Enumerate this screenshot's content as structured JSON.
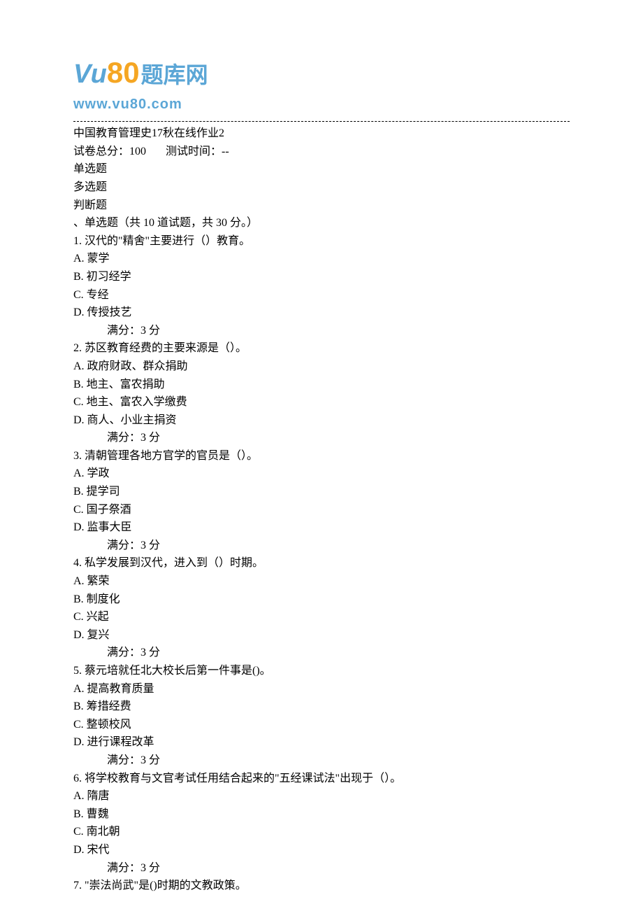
{
  "logo": {
    "vu": "Vu",
    "eighty": "80",
    "text": "题库网",
    "url": "www.vu80.com"
  },
  "header": {
    "title": "中国教育管理史17秋在线作业2",
    "total_label": "试卷总分：",
    "total_value": "100",
    "time_label": "测试时间：",
    "time_value": "--"
  },
  "types": {
    "single": "单选题",
    "multi": "多选题",
    "judge": "判断题"
  },
  "section_header": "、单选题（共 10 道试题，共 30 分。）",
  "score_text": "满分：3  分",
  "questions": [
    {
      "stem": "1.  汉代的\"精舍\"主要进行（）教育。",
      "options": [
        "A. 蒙学",
        "B. 初习经学",
        "C. 专经",
        "D. 传授技艺"
      ]
    },
    {
      "stem": "2.  苏区教育经费的主要来源是（）。",
      "options": [
        "A. 政府财政、群众捐助",
        "B. 地主、富农捐助",
        "C. 地主、富农入学缴费",
        "D. 商人、小业主捐资"
      ]
    },
    {
      "stem": "3.  清朝管理各地方官学的官员是（）。",
      "options": [
        "A. 学政",
        "B. 提学司",
        "C. 国子祭酒",
        "D. 监事大臣"
      ]
    },
    {
      "stem": "4.  私学发展到汉代，进入到（）时期。",
      "options": [
        "A. 繁荣",
        "B. 制度化",
        "C. 兴起",
        "D. 复兴"
      ]
    },
    {
      "stem": "5.  蔡元培就任北大校长后第一件事是()。",
      "options": [
        "A. 提高教育质量",
        "B. 筹措经费",
        "C. 整顿校风",
        "D. 进行课程改革"
      ]
    },
    {
      "stem": "6.  将学校教育与文官考试任用结合起来的\"五经课试法\"出现于（）。",
      "options": [
        "A. 隋唐",
        "B. 曹魏",
        "C. 南北朝",
        "D. 宋代"
      ]
    },
    {
      "stem": "7.  \"崇法尚武\"是()时期的文教政策。",
      "options": []
    }
  ]
}
